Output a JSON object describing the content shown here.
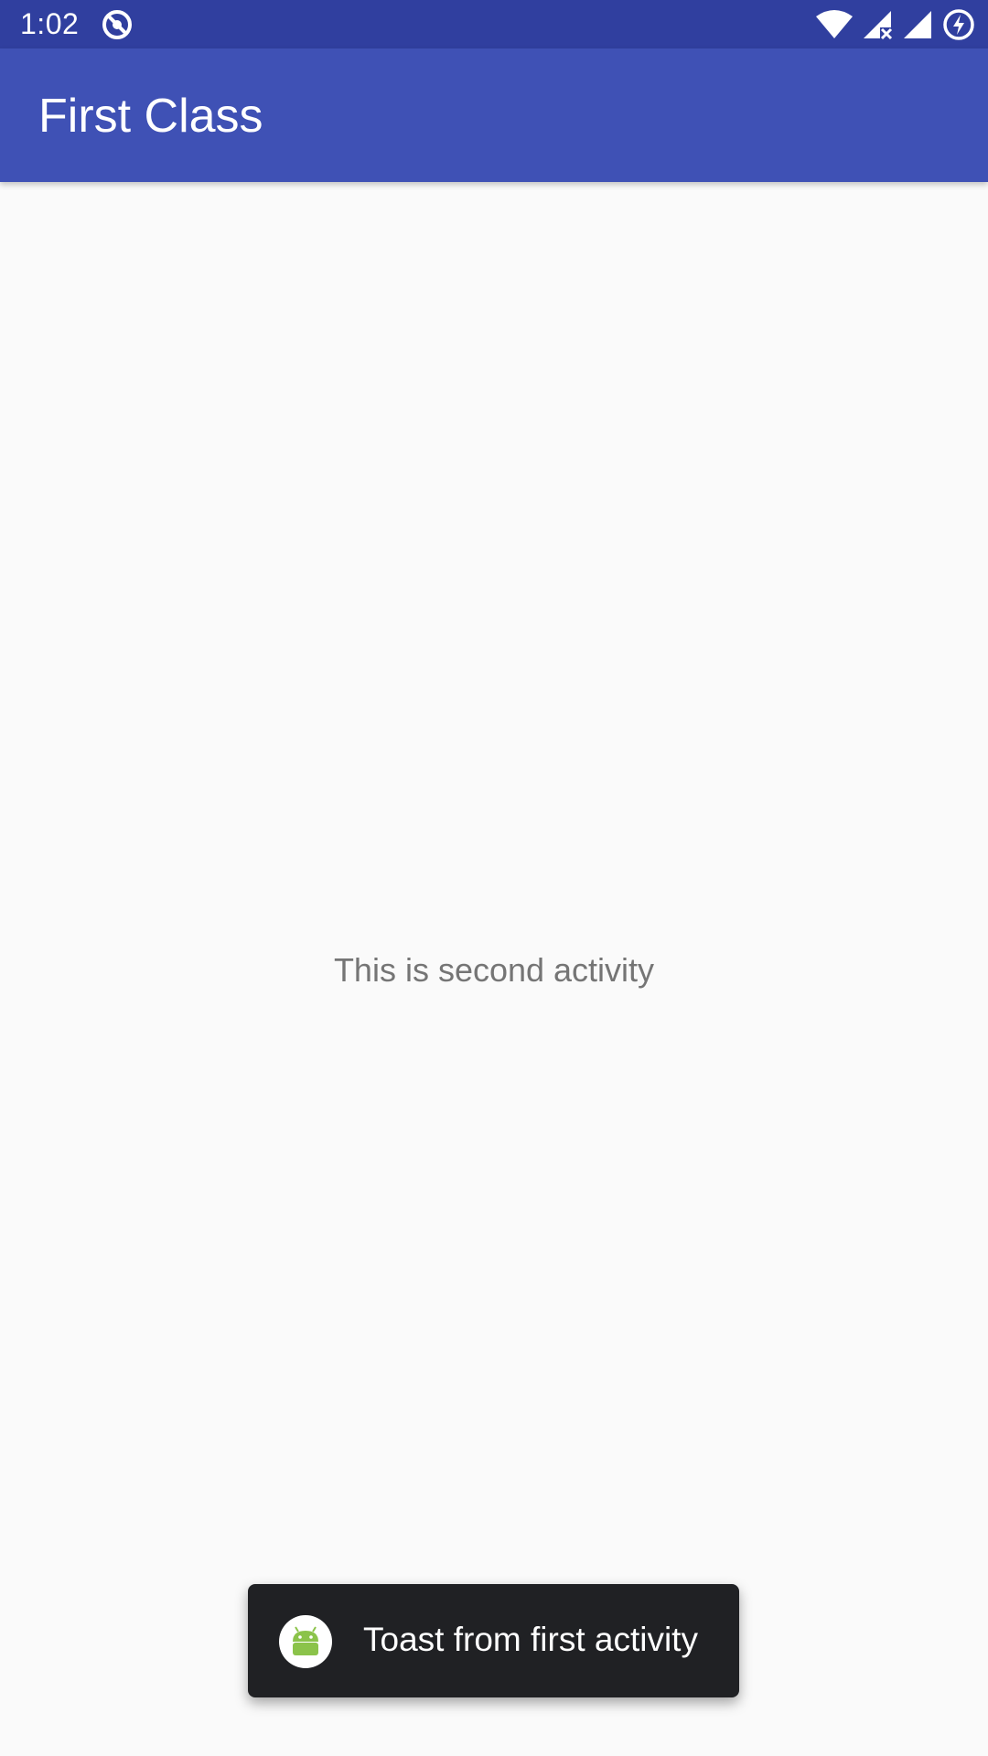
{
  "status_bar": {
    "time": "1:02",
    "icons": [
      "do-not-disturb-icon",
      "wifi-icon",
      "signal-no-data-icon",
      "signal-icon",
      "battery-charging-icon"
    ],
    "color": "#303f9f"
  },
  "app_bar": {
    "title": "First Class",
    "color": "#3f51b5"
  },
  "main": {
    "message": "This is second activity"
  },
  "toast": {
    "icon": "android-icon",
    "text": "Toast from first activity",
    "background": "#202124"
  }
}
